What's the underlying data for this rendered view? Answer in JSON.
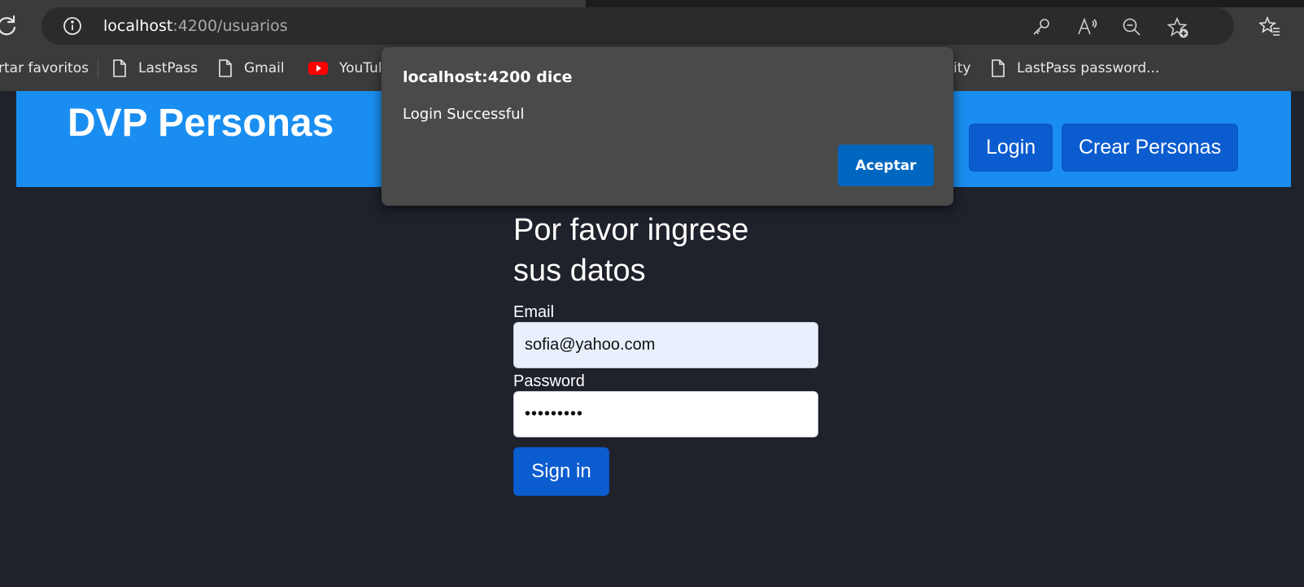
{
  "browser": {
    "url_host": "localhost",
    "url_rest": ":4200/usuarios",
    "bookmarks": [
      "rtar favoritos",
      "LastPass",
      "Gmail",
      "YouTul",
      "ity",
      "LastPass password..."
    ]
  },
  "navbar": {
    "brand": "DVP Personas",
    "login_label": "Login",
    "crear_label": "Crear Personas"
  },
  "form": {
    "title": "Por favor ingrese sus datos",
    "email_label": "Email",
    "email_value": "sofia@yahoo.com",
    "password_label": "Password",
    "password_value": "•••••••••",
    "submit_label": "Sign in"
  },
  "dialog": {
    "title": "localhost:4200 dice",
    "message": "Login Successful",
    "ok_label": "Aceptar"
  },
  "colors": {
    "navbar": "#1a8ef0",
    "button": "#0b5ccf",
    "page_bg": "#1f212b",
    "dialog_bg": "#4a4a4a",
    "dialog_button": "#0067c0"
  }
}
